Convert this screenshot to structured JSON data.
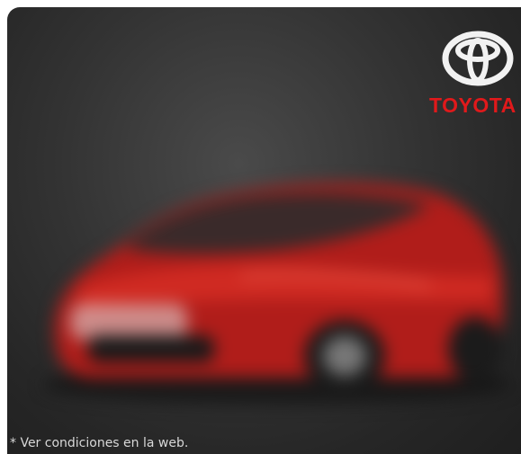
{
  "ad": {
    "brand": "TOYOTA",
    "disclaimer": "* Ver condiciones en la web."
  },
  "colors": {
    "background_dark": "#262626",
    "brand_red": "#e0191b",
    "car_red": "#c0201c",
    "logo_white": "#f2f2f2"
  },
  "icons": {
    "logo": "toyota-emblem-icon",
    "car": "red-hatchback-car-image"
  }
}
